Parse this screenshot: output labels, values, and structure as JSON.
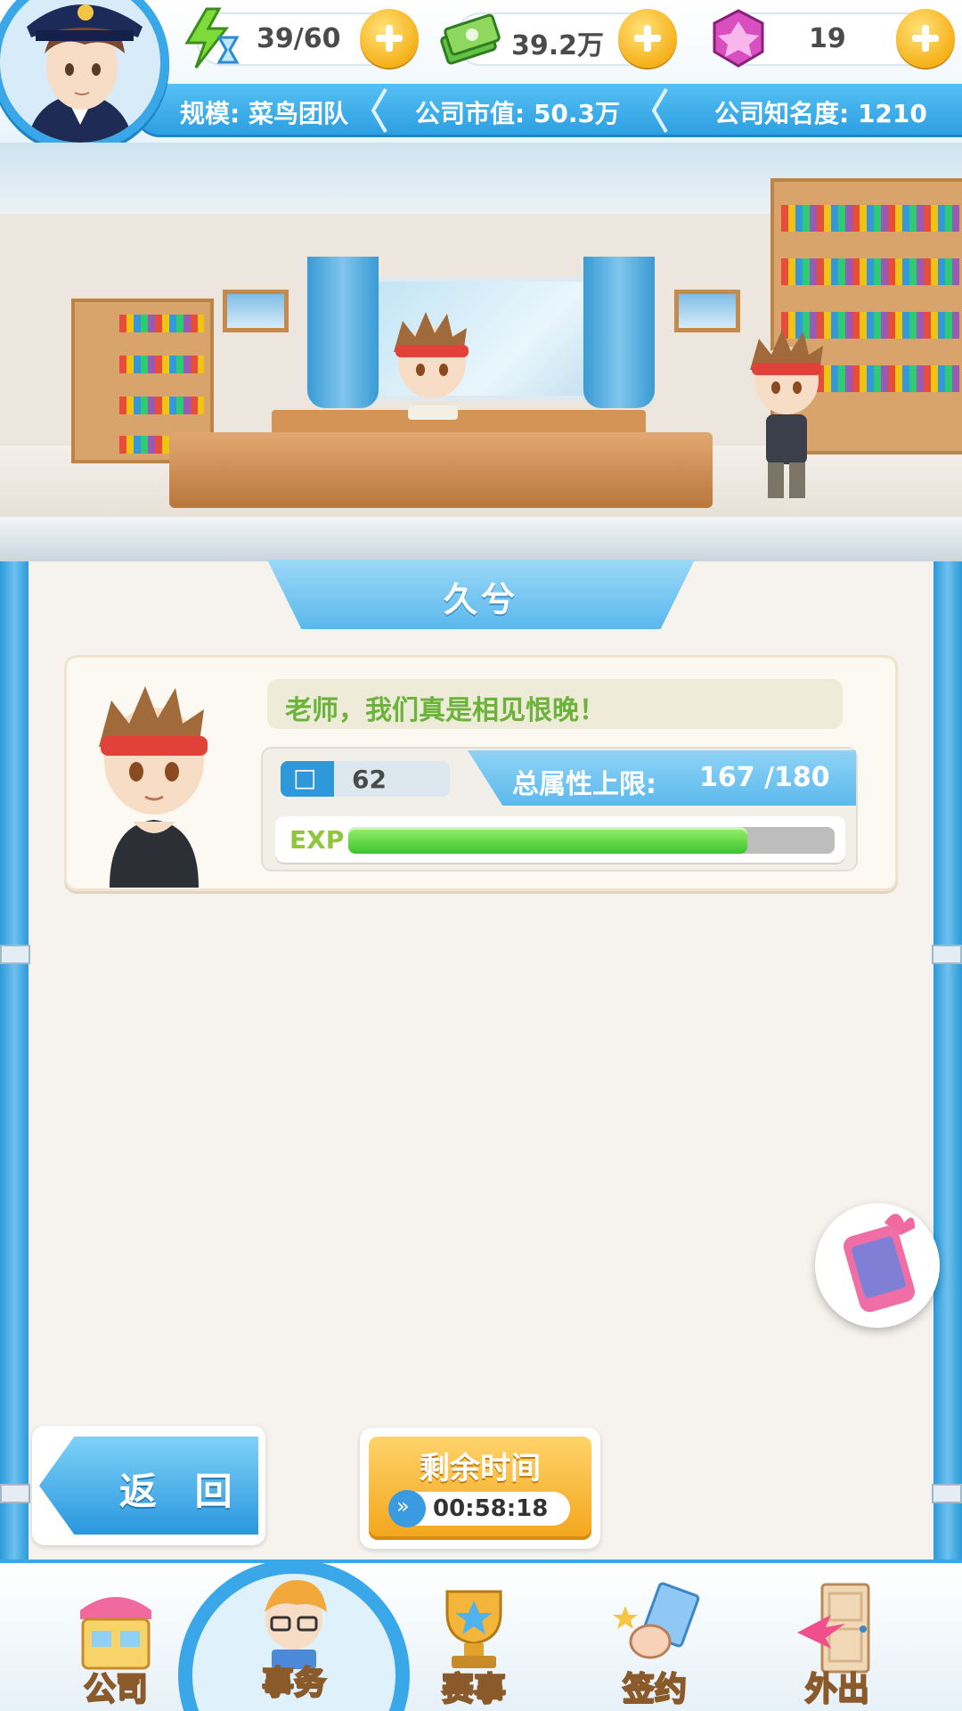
{
  "resources": {
    "stamina": {
      "value": "39/60",
      "icon": "stamina-icon"
    },
    "money": {
      "value": "39.2万",
      "icon": "cash-icon"
    },
    "gems": {
      "value": "19",
      "icon": "gem-icon"
    }
  },
  "stats": {
    "scale": "规模: 菜鸟团队",
    "market_value": "公司市值: 50.3万",
    "fame": "公司知名度: 1210"
  },
  "character": {
    "name": "久兮",
    "dialogue": "老师，我们真是相见恨晚！",
    "level_icon_text": "□",
    "level": "62",
    "attr_label": "总属性上限:",
    "attr_value": "167 /180",
    "exp_label": "EXP",
    "exp_progress": 0.82
  },
  "buttons": {
    "back": "返 回",
    "timer_title": "剩余时间",
    "timer_value": "00:58:18"
  },
  "nav": {
    "items": [
      {
        "label": "公司",
        "icon": "company-icon"
      },
      {
        "label": "事务",
        "icon": "affairs-icon"
      },
      {
        "label": "赛事",
        "icon": "trophy-icon"
      },
      {
        "label": "签约",
        "icon": "contract-icon"
      },
      {
        "label": "外出",
        "icon": "door-icon"
      }
    ]
  },
  "colors": {
    "accent_blue": "#3aa7e8",
    "gold": "#f6b21b",
    "exp_green": "#3cc52e",
    "dialogue_green": "#6bb33a"
  }
}
